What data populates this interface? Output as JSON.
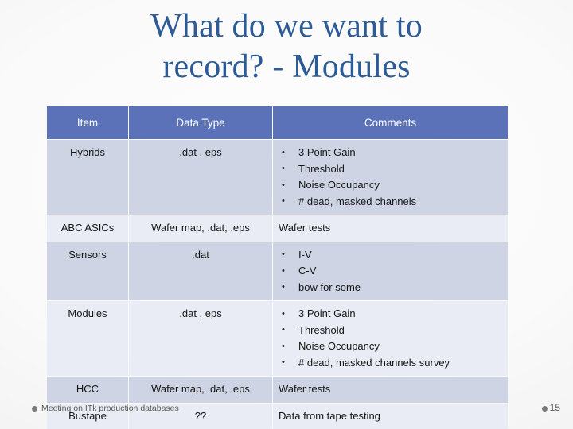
{
  "slide": {
    "title_lines": [
      "What do we want to",
      "record? - Modules"
    ],
    "accent_header_color": "#5B72B8",
    "title_color": "#2C5B97",
    "row_shade_dark": "#CED4E4",
    "row_shade_light": "#E9ECF4"
  },
  "table": {
    "headers": {
      "item": "Item",
      "data_type": "Data Type",
      "comments": "Comments"
    },
    "rows": [
      {
        "item": "Hybrids",
        "data_type": ".dat , eps",
        "comments_bullets": [
          "3 Point Gain",
          "Threshold",
          "Noise Occupancy",
          "# dead, masked channels"
        ],
        "comments_text": ""
      },
      {
        "item": "ABC ASICs",
        "data_type": "Wafer map, .dat, .eps",
        "comments_bullets": [],
        "comments_text": "Wafer tests"
      },
      {
        "item": "Sensors",
        "data_type": ".dat",
        "comments_bullets": [
          "I-V",
          "C-V",
          "bow for some"
        ],
        "comments_text": ""
      },
      {
        "item": "Modules",
        "data_type": ".dat , eps",
        "comments_bullets": [
          "3 Point Gain",
          "Threshold",
          "Noise Occupancy",
          "# dead, masked  channels survey"
        ],
        "comments_text": ""
      },
      {
        "item": "HCC",
        "data_type": "Wafer map, .dat, .eps",
        "comments_bullets": [],
        "comments_text": "Wafer tests"
      },
      {
        "item": "Bustape",
        "data_type": "??",
        "comments_bullets": [],
        "comments_text": "Data from tape testing"
      }
    ]
  },
  "footer": {
    "left_text": "Meeting on ITk production databases",
    "page_number": "15"
  }
}
